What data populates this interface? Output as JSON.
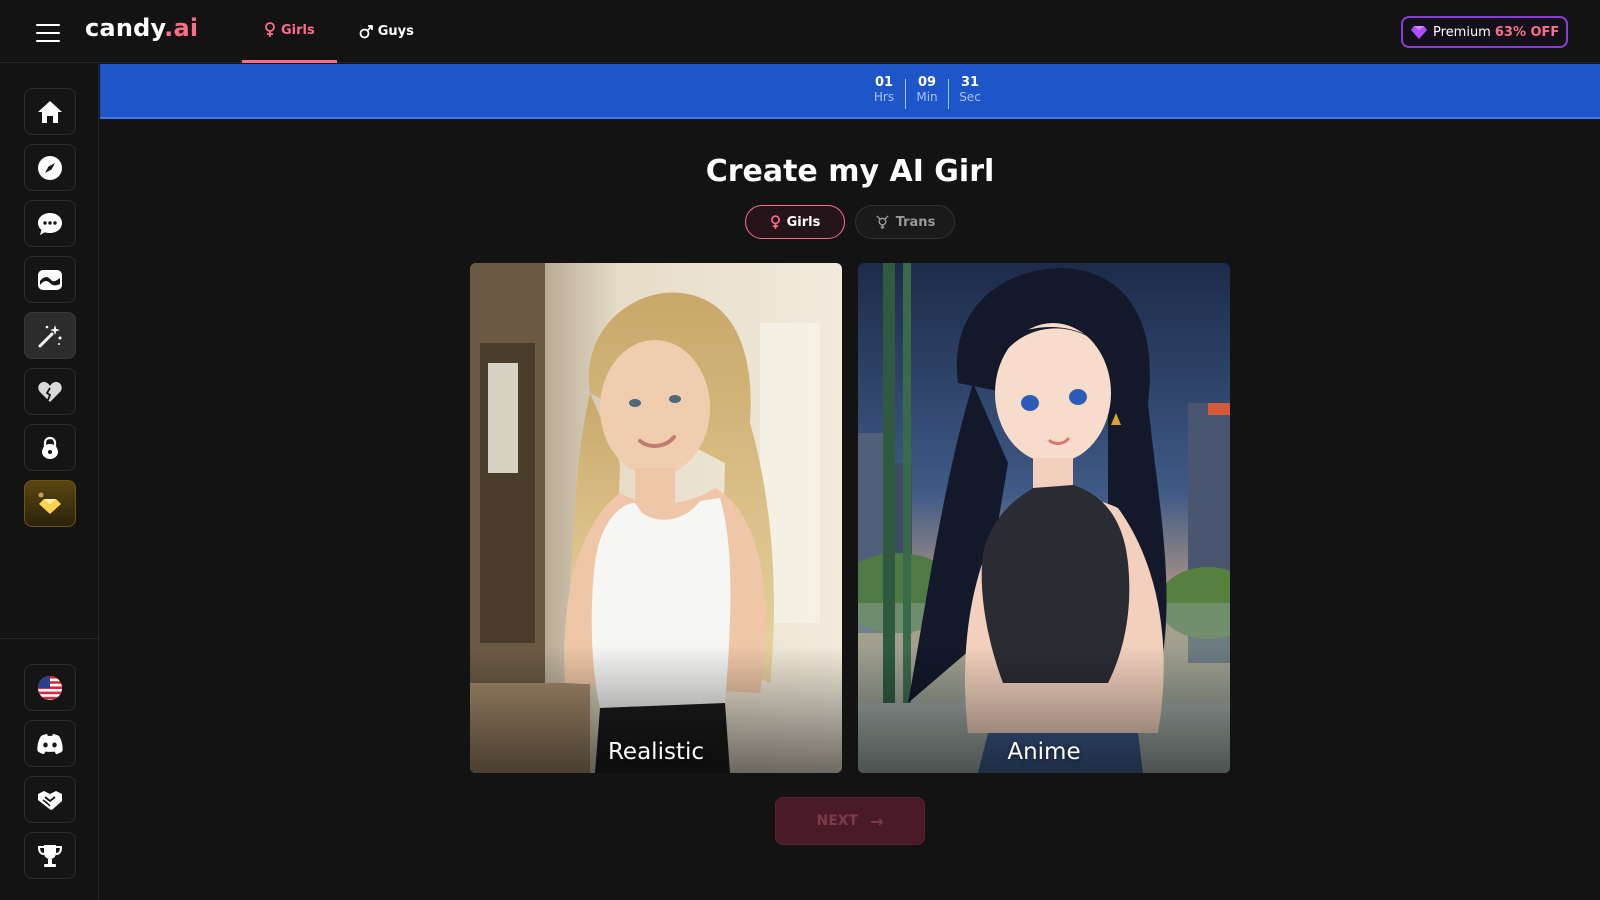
{
  "header": {
    "logo_main": "candy",
    "logo_accent": ".ai",
    "nav": [
      {
        "label": "Girls",
        "active": true
      },
      {
        "label": "Guys",
        "active": false
      }
    ],
    "premium_label": "Premium",
    "premium_discount": "63% OFF"
  },
  "sidebar": {
    "top_items": [
      "home-icon",
      "compass-icon",
      "chat-icon",
      "gallery-icon",
      "magic-wand-icon",
      "heart-icon",
      "lock-icon",
      "diamond-icon"
    ],
    "active_item": "magic-wand-icon",
    "bottom_items": [
      "us-flag-icon",
      "discord-icon",
      "handshake-icon",
      "trophy-icon"
    ]
  },
  "countdown": {
    "hours": "01",
    "hours_label": "Hrs",
    "minutes": "09",
    "minutes_label": "Min",
    "seconds": "31",
    "seconds_label": "Sec"
  },
  "main": {
    "title": "Create my AI Girl",
    "filters": [
      {
        "label": "Girls",
        "selected": true
      },
      {
        "label": "Trans",
        "selected": false
      }
    ],
    "styles": [
      {
        "label": "Realistic"
      },
      {
        "label": "Anime"
      }
    ],
    "next_label": "NEXT"
  },
  "colors": {
    "accent": "#ff6b8a",
    "banner": "#1e55c8",
    "premium_border": "#8a3cd6",
    "background": "#131313"
  }
}
